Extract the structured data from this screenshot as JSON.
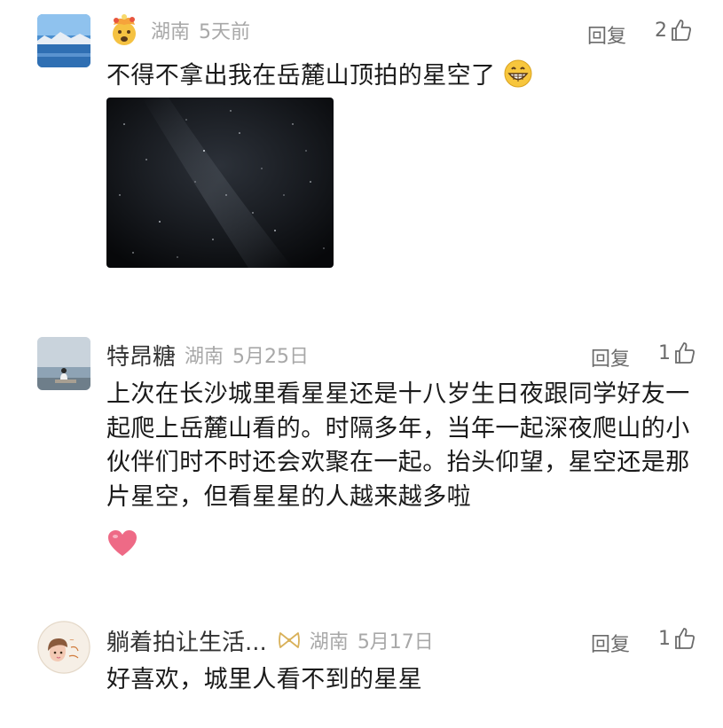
{
  "comments": [
    {
      "username": "",
      "location": "湖南",
      "time": "5天前",
      "reply_label": "回复",
      "likes": "2",
      "text": "不得不拿出我在岳麓山顶拍的星空了",
      "emoji": "grinning-face",
      "has_photo": true
    },
    {
      "username": "特昂糖",
      "location": "湖南",
      "time": "5月25日",
      "reply_label": "回复",
      "likes": "1",
      "text": "上次在长沙城里看星星还是十八岁生日夜跟同学好友一起爬上岳麓山看的。时隔多年，当年一起深夜爬山的小伙伴们时不时还会欢聚在一起。抬头仰望，星空还是那片星空，但看星星的人越来越多啦",
      "emoji": "pink-heart"
    },
    {
      "username": "躺着拍让生活...",
      "location": "湖南",
      "time": "5月17日",
      "reply_label": "回复",
      "likes": "1",
      "text": "好喜欢，城里人看不到的星星",
      "badge_icon": "bow-badge"
    }
  ],
  "colors": {
    "meta_gray": "#a8a8a8",
    "action_gray": "#6b6b6b",
    "text": "#1a1a1a",
    "heart": "#e85a76"
  },
  "icons": {
    "like": "thumbs-up-icon",
    "avatar1": "landscape-lake-avatar",
    "avatar2": "person-sitting-by-sea-avatar",
    "avatar3": "cartoon-girl-avatar",
    "user1_badge": "exploding-head-emoji"
  }
}
